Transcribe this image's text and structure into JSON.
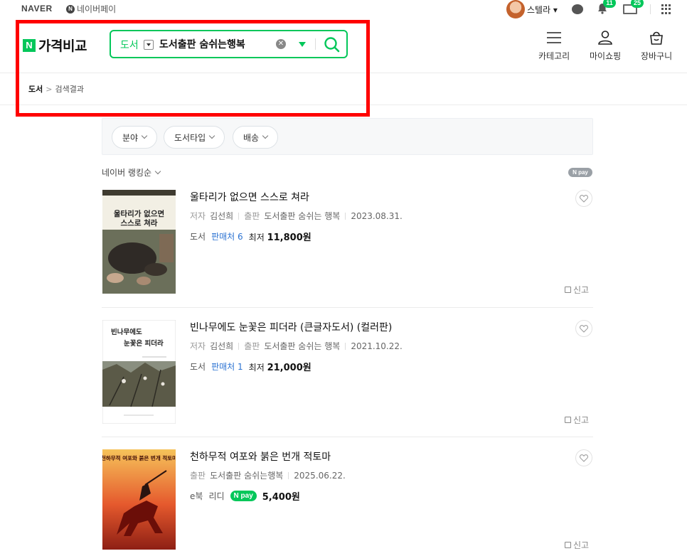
{
  "topbar": {
    "naver": "NAVER",
    "npay_n": "N",
    "npay": "네이버페이",
    "username": "스텔라 ▾",
    "bell_count": "11",
    "mail_count": "25"
  },
  "header": {
    "logo_n": "N",
    "logo_text": "가격비교",
    "search_category": "도서",
    "search_value": "도서출판 숨쉬는행복",
    "nav": {
      "category": "카테고리",
      "myshopping": "마이쇼핑",
      "cart": "장바구니"
    }
  },
  "breadcrumb": {
    "root": "도서",
    "sep": ">",
    "current": "검색결과"
  },
  "filters": [
    {
      "label": "분야"
    },
    {
      "label": "도서타입"
    },
    {
      "label": "배송"
    }
  ],
  "sort": {
    "label": "네이버 랭킹순",
    "npay": "N pay"
  },
  "products": [
    {
      "title": "울타리가 없으면 스스로 쳐라",
      "cover_text": "울타리가 없으면 스스로 쳐라",
      "meta": [
        {
          "key": "저자",
          "value": "김선희"
        },
        {
          "key": "출판",
          "value": "도서출판 숨쉬는 행복"
        },
        {
          "key": "",
          "value": "2023.08.31."
        }
      ],
      "type": "도서",
      "sellers": "판매처 6",
      "lowest_label": "최저",
      "price": "11,800원",
      "report": "신고"
    },
    {
      "title": "빈나무에도 눈꽃은 피더라 (큰글자도서) (컬러판)",
      "cover_text_1": "빈나무에도",
      "cover_text_2": "눈꽃은 피더라",
      "meta": [
        {
          "key": "저자",
          "value": "김선희"
        },
        {
          "key": "출판",
          "value": "도서출판 숨쉬는 행복"
        },
        {
          "key": "",
          "value": "2021.10.22."
        }
      ],
      "type": "도서",
      "sellers": "판매처 1",
      "lowest_label": "최저",
      "price": "21,000원",
      "report": "신고"
    },
    {
      "title": "천하무적 여포와 붉은 번개 적토마",
      "cover_text": "천하무적 여포와 붉은 번개 적토마",
      "meta": [
        {
          "key": "출판",
          "value": "도서출판 숨쉬는행복"
        },
        {
          "key": "",
          "value": "2025.06.22."
        }
      ],
      "type": "e북",
      "store": "리디",
      "npay": "N pay",
      "price": "5,400원",
      "report": "신고"
    }
  ],
  "colors": {
    "naver_green": "#03c75a",
    "highlight_red": "#ff0000",
    "link_blue": "#2c73d2"
  }
}
